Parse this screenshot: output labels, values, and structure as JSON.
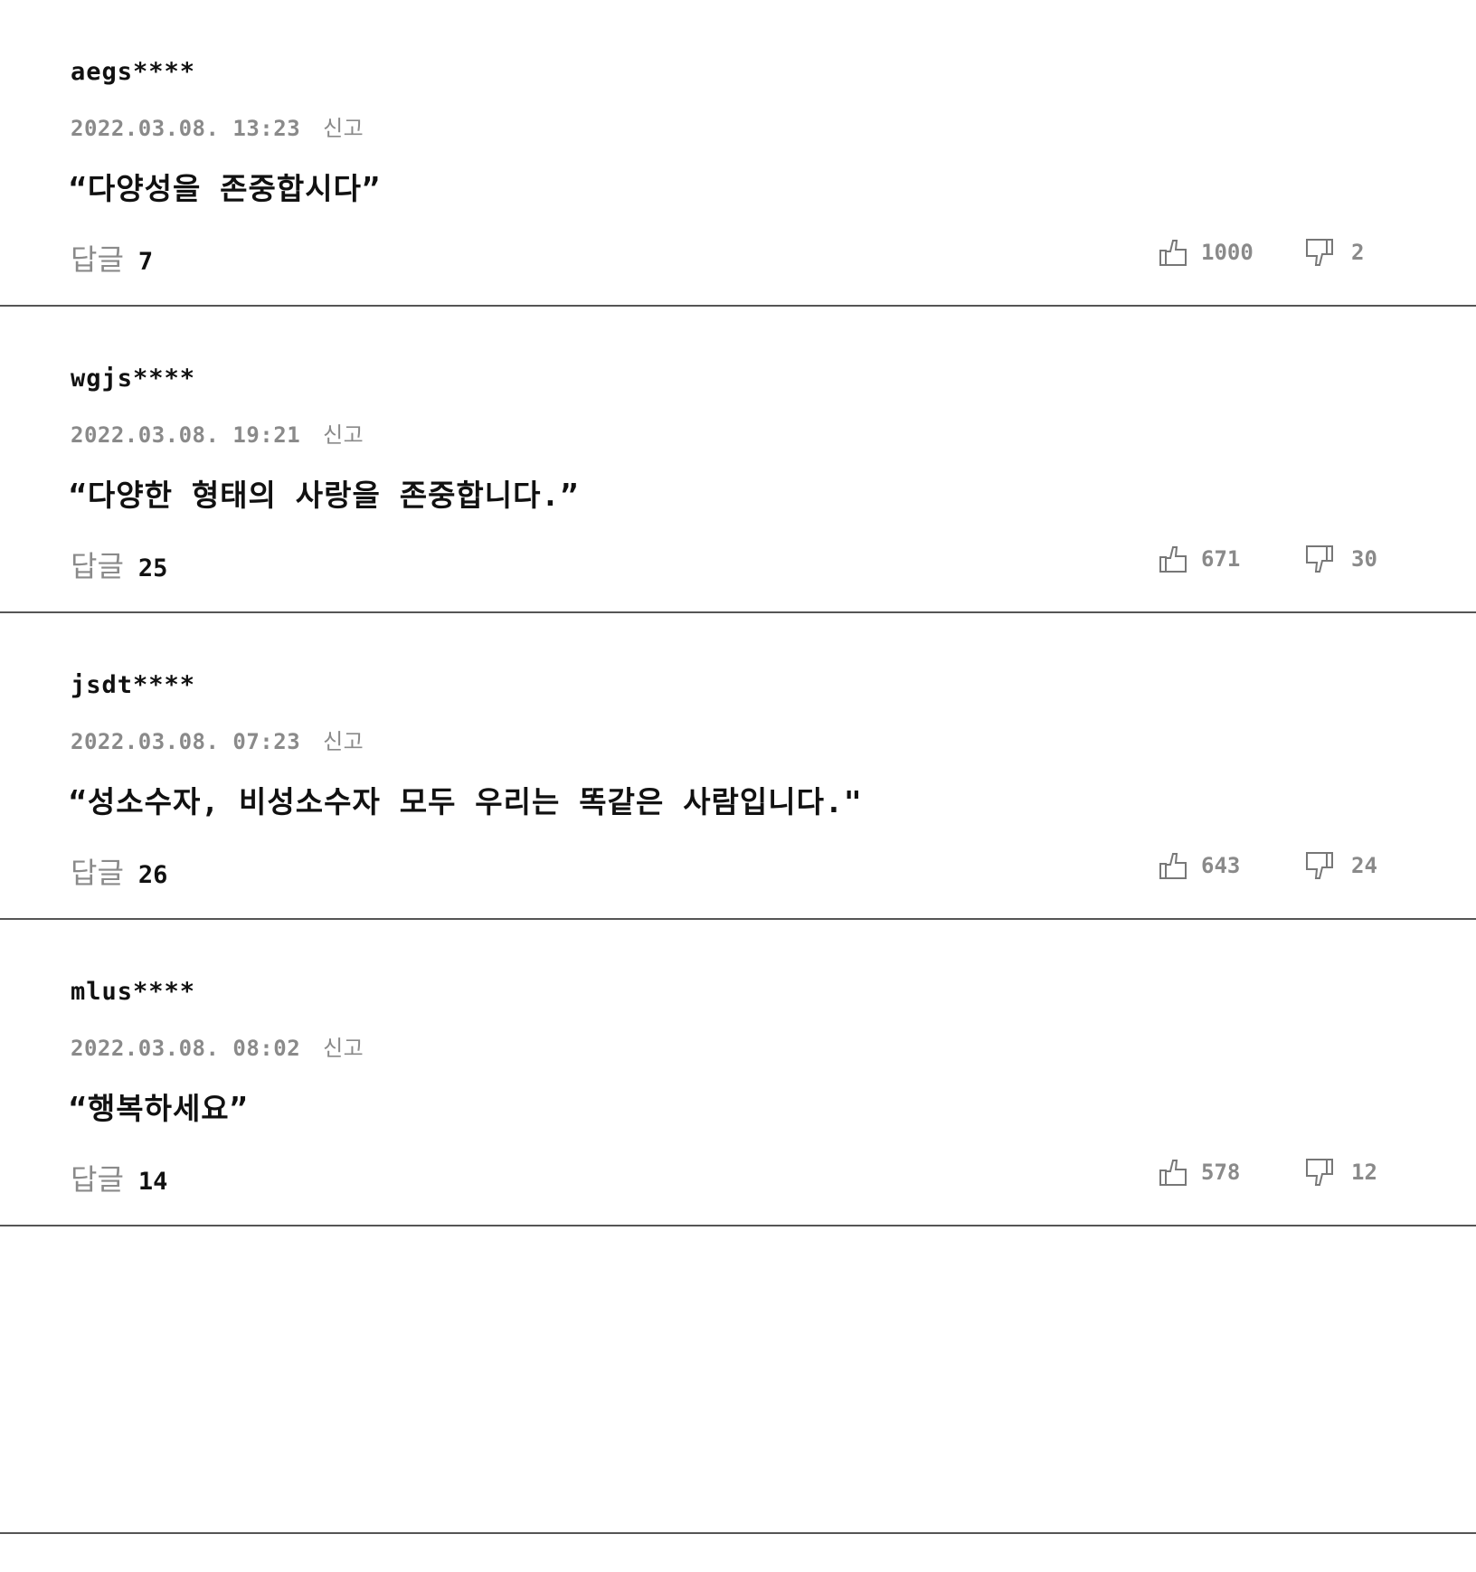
{
  "reply_label": "답글",
  "report_label": "신고",
  "comments": [
    {
      "username": "aegs****",
      "datetime": "2022.03.08. 13:23",
      "text": "“다양성을 존중합시다”",
      "reply_count": "7",
      "likes": "1000",
      "dislikes": "2"
    },
    {
      "username": "wgjs****",
      "datetime": "2022.03.08. 19:21",
      "text": "“다양한 형태의 사랑을 존중합니다.”",
      "reply_count": "25",
      "likes": "671",
      "dislikes": "30"
    },
    {
      "username": "jsdt****",
      "datetime": "2022.03.08. 07:23",
      "text": "“성소수자, 비성소수자 모두 우리는 똑같은 사람입니다.\"",
      "reply_count": "26",
      "likes": "643",
      "dislikes": "24"
    },
    {
      "username": "mlus****",
      "datetime": "2022.03.08. 08:02",
      "text": "“행복하세요”",
      "reply_count": "14",
      "likes": "578",
      "dislikes": "12"
    }
  ],
  "icons": {
    "like": "thumbs-up-icon",
    "dislike": "thumbs-down-icon"
  },
  "colors": {
    "text": "#111111",
    "muted": "#8a8a8a",
    "divider": "#555555"
  }
}
